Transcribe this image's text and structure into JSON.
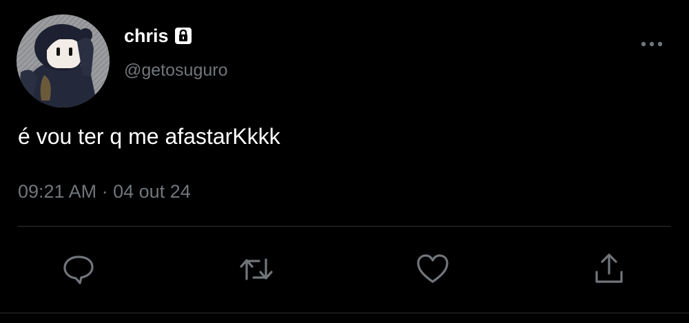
{
  "tweet": {
    "author": {
      "display_name": "chris",
      "handle": "@getosuguro",
      "protected_icon": "lock-icon",
      "avatar": "avatar"
    },
    "text": "é vou ter q me afastarKkkk",
    "time": "09:21 AM",
    "separator": "·",
    "date": "04 out 24",
    "more_icon": "more-icon"
  },
  "actions": [
    {
      "name": "reply",
      "icon": "reply-icon"
    },
    {
      "name": "retweet",
      "icon": "retweet-icon"
    },
    {
      "name": "like",
      "icon": "heart-icon"
    },
    {
      "name": "share",
      "icon": "share-icon"
    }
  ],
  "colors": {
    "background": "#000000",
    "primary_text": "#ffffff",
    "secondary_text": "#71767b",
    "divider": "#2f3336"
  }
}
